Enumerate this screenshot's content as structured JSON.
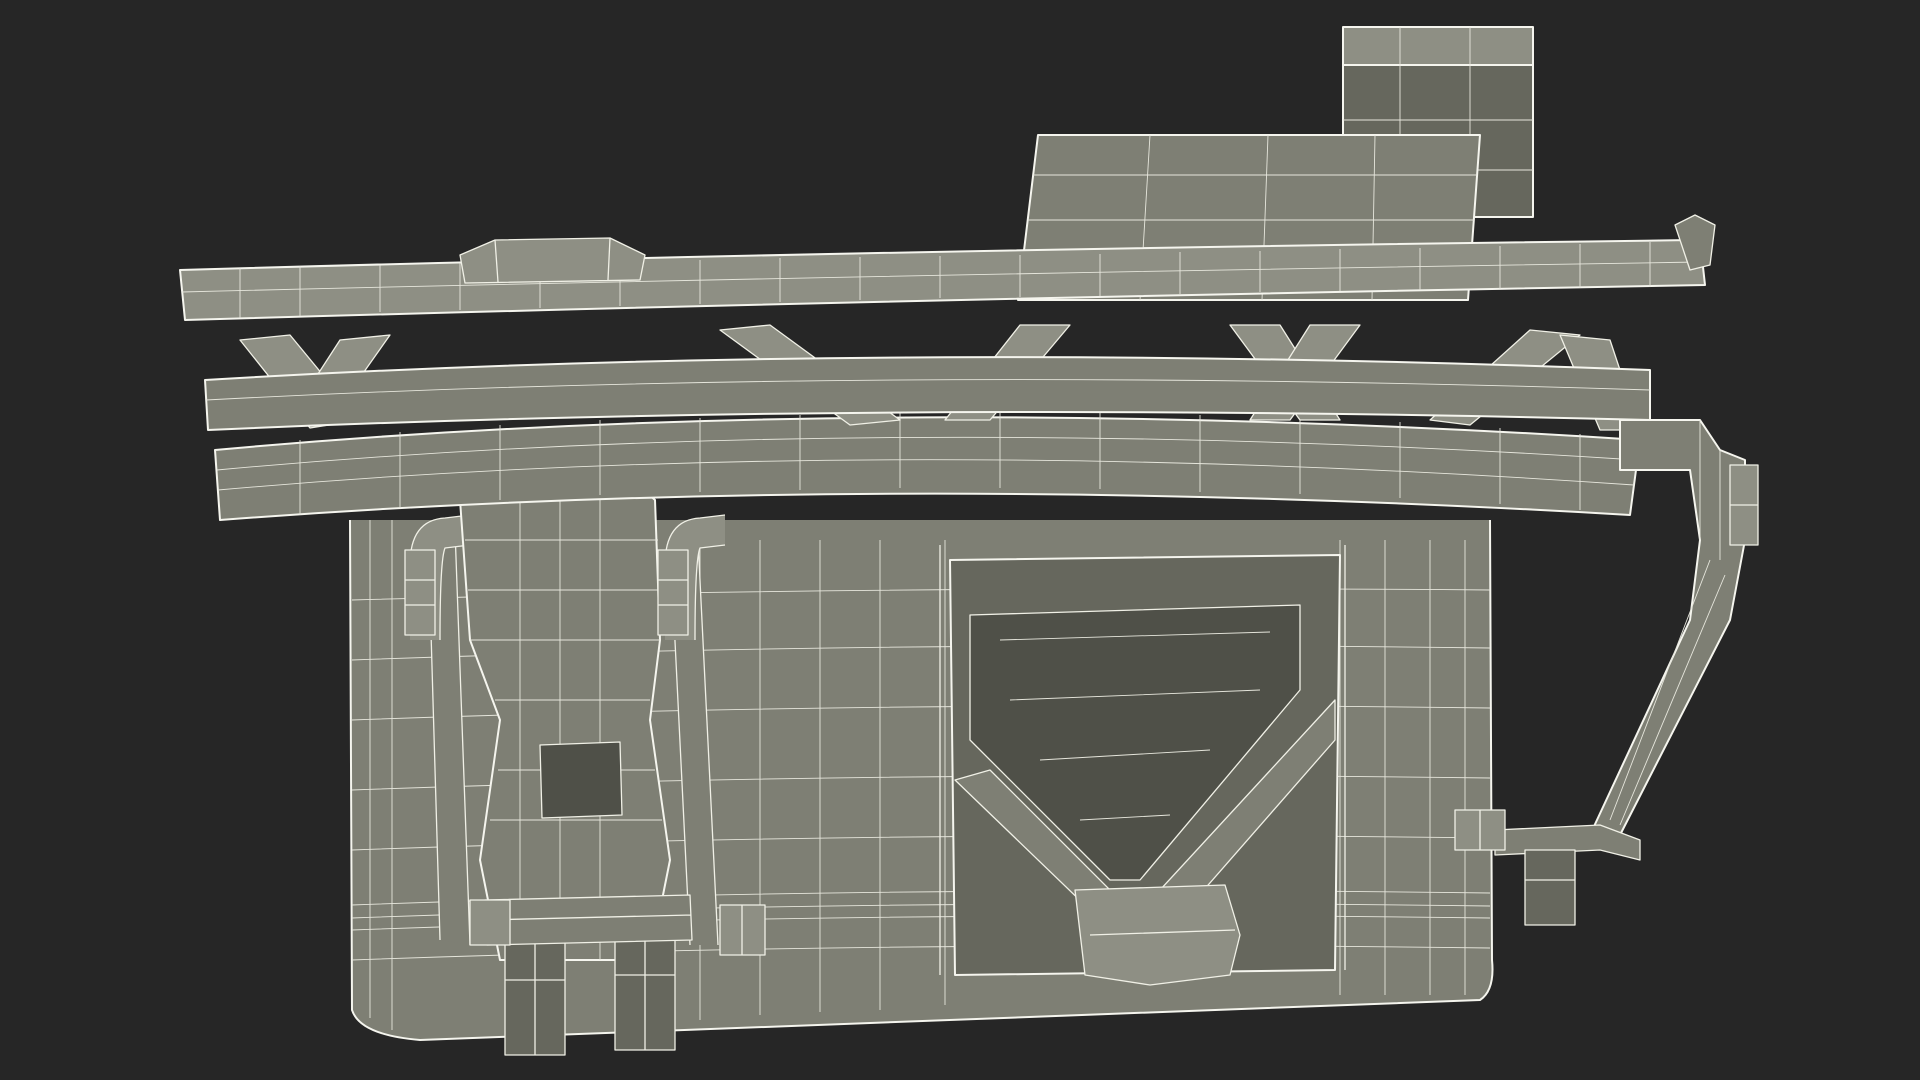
{
  "scene": {
    "subject": "",
    "render_style": "wireframe-over-shaded",
    "colors": {
      "background": "#262626",
      "surface": "#7e7f74",
      "wire": "#f0f0e6"
    }
  }
}
